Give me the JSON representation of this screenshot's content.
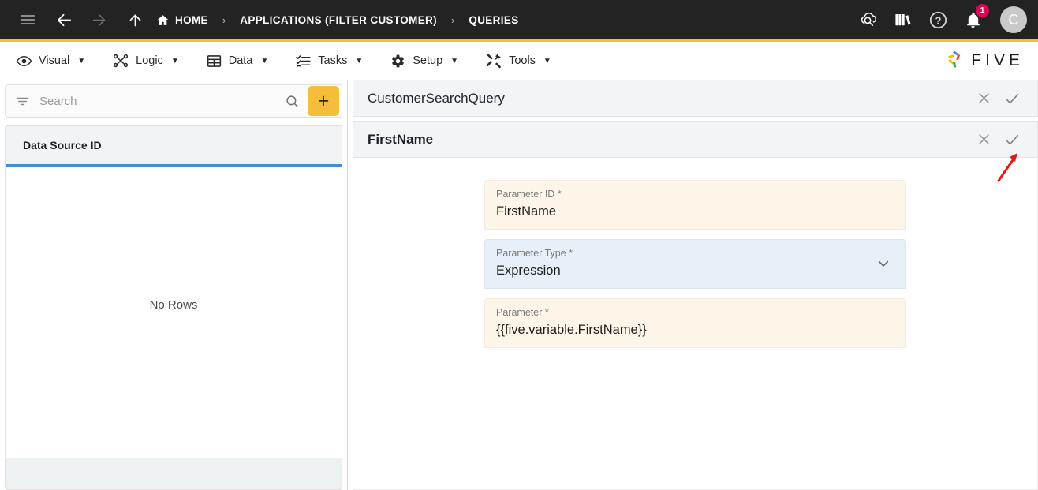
{
  "topbar": {
    "icons": {
      "menu": "hamburger-menu-icon",
      "back": "back-arrow-icon",
      "forward": "forward-arrow-icon",
      "up": "up-arrow-icon",
      "home": "home-icon"
    },
    "breadcrumbs": [
      {
        "label": "HOME",
        "icon": "home-icon"
      },
      {
        "label": "APPLICATIONS (FILTER CUSTOMER)",
        "icon": ""
      },
      {
        "label": "QUERIES",
        "icon": ""
      }
    ],
    "separator": "›",
    "right_icons": [
      {
        "name": "cloud-search-icon",
        "label": ""
      },
      {
        "name": "library-books-icon",
        "label": ""
      },
      {
        "name": "help-icon",
        "label": ""
      },
      {
        "name": "notifications-bell-icon",
        "label": ""
      }
    ],
    "notification_count": "1",
    "avatar_initial": "C",
    "accent_underline": "#f5bf2e",
    "background": "#232323"
  },
  "menubar": {
    "items": [
      {
        "label": "Visual",
        "icon": "eye-icon",
        "caret": "▼"
      },
      {
        "label": "Logic",
        "icon": "logic-nodes-icon",
        "caret": "▼"
      },
      {
        "label": "Data",
        "icon": "data-grid-icon",
        "caret": "▼"
      },
      {
        "label": "Tasks",
        "icon": "tasks-list-icon",
        "caret": "▼"
      },
      {
        "label": "Setup",
        "icon": "gear-icon",
        "caret": "▼"
      },
      {
        "label": "Tools",
        "icon": "tools-icon",
        "caret": "▼"
      }
    ],
    "brand": {
      "name": "five-logo-icon",
      "word": "FIVE"
    }
  },
  "sidebar": {
    "search": {
      "placeholder": "Search",
      "value": "",
      "filter_icon": "filter-icon",
      "search_icon": "search-icon"
    },
    "add_button": {
      "label": "+",
      "color": "#f5be3a"
    },
    "grid": {
      "columns": [
        {
          "label": "Data Source ID"
        }
      ],
      "rows": [],
      "empty_text": "No Rows",
      "header_accent": "#3f8ddb"
    }
  },
  "main": {
    "query_panel": {
      "title": "CustomerSearchQuery",
      "close_icon": "close-icon",
      "save_icon": "check-icon"
    },
    "parameter_panel": {
      "title": "FirstName",
      "close_icon": "close-icon",
      "save_icon": "check-icon"
    },
    "fields": [
      {
        "label": "Parameter ID *",
        "value": "FirstName",
        "style": "cream",
        "control": "text",
        "name": "parameter-id-field"
      },
      {
        "label": "Parameter Type *",
        "value": "Expression",
        "style": "blue",
        "control": "select",
        "chevron": "chevron-down-icon",
        "name": "parameter-type-field"
      },
      {
        "label": "Parameter *",
        "value": "{{five.variable.FirstName}}",
        "style": "cream",
        "control": "text",
        "name": "parameter-field"
      }
    ]
  },
  "annotation": {
    "arrow": "red-pointer-arrow",
    "color": "#e01b1b"
  }
}
